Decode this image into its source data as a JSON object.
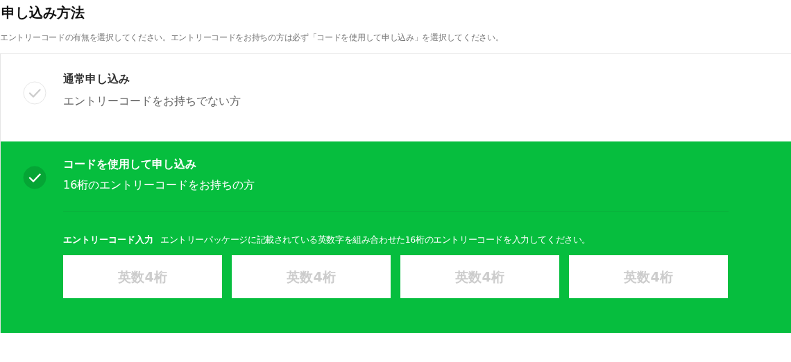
{
  "heading": "申し込み方法",
  "description": "エントリーコードの有無を選択してください。エントリーコードをお持ちの方は必ず「コードを使用して申し込み」を選択してください。",
  "options": [
    {
      "title": "通常申し込み",
      "subtitle": "エントリーコードをお持ちでない方",
      "selected": false
    },
    {
      "title": "コードを使用して申し込み",
      "subtitle": "16桁のエントリーコードをお持ちの方",
      "selected": true
    }
  ],
  "code_entry": {
    "label": "エントリーコード入力",
    "hint": "エントリーパッケージに記載されている英数字を組み合わせた16桁のエントリーコードを入力してください。",
    "fields": [
      {
        "placeholder": "英数4桁"
      },
      {
        "placeholder": "英数4桁"
      },
      {
        "placeholder": "英数4桁"
      },
      {
        "placeholder": "英数4桁"
      }
    ]
  }
}
